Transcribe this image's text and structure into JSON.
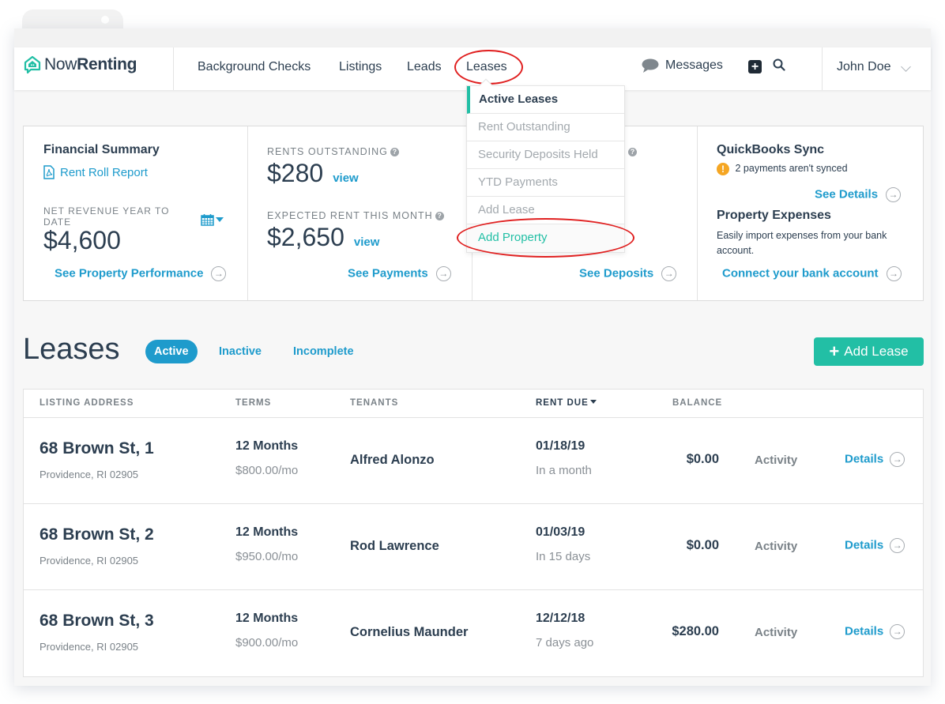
{
  "app": {
    "brand_light": "Now",
    "brand_bold": "Renting",
    "colors": {
      "brand_teal": "#22bfa5",
      "link_blue": "#1e9bcc",
      "text_dark": "#2c3e50",
      "warning": "#f5a623",
      "annotation_red": "#e02020"
    }
  },
  "nav": {
    "items": [
      "Background Checks",
      "Listings",
      "Leads",
      "Leases"
    ],
    "messages_label": "Messages",
    "user_name": "John Doe",
    "icons": {
      "messages": "speech-bubble-icon",
      "add": "plus-square-icon",
      "search": "magnifier-icon",
      "user_menu": "chevron-down-icon"
    }
  },
  "leases_menu": {
    "items": [
      {
        "label": "Active Leases",
        "state": "active"
      },
      {
        "label": "Rent Outstanding",
        "state": "normal"
      },
      {
        "label": "Security Deposits Held",
        "state": "normal"
      },
      {
        "label": "YTD Payments",
        "state": "normal"
      },
      {
        "label": "Add Lease",
        "state": "normal"
      },
      {
        "label": "Add Property",
        "state": "highlighted"
      }
    ]
  },
  "summary": {
    "financial": {
      "title": "Financial Summary",
      "report_link": "Rent Roll Report",
      "net_revenue_label": "NET REVENUE YEAR TO DATE",
      "net_revenue_value": "$4,600",
      "footer_link": "See Property Performance"
    },
    "rents": {
      "outstanding_label": "RENTS OUTSTANDING",
      "outstanding_value": "$280",
      "outstanding_view": "view",
      "expected_label": "EXPECTED RENT THIS MONTH",
      "expected_value": "$2,650",
      "expected_view": "view",
      "footer_link": "See Payments"
    },
    "deposits": {
      "footer_link": "See Deposits"
    },
    "quickbooks": {
      "title": "QuickBooks Sync",
      "warning_text": "2 payments aren't synced",
      "details_link": "See Details",
      "expenses_title": "Property Expenses",
      "expenses_text": "Easily import expenses from your bank account.",
      "connect_link": "Connect your bank account"
    }
  },
  "leases": {
    "title": "Leases",
    "filters": [
      "Active",
      "Inactive",
      "Incomplete"
    ],
    "active_filter": "Active",
    "add_button": "Add Lease",
    "columns": [
      "LISTING ADDRESS",
      "TERMS",
      "TENANTS",
      "RENT DUE",
      "BALANCE"
    ],
    "sorted_column": "RENT DUE",
    "rows": [
      {
        "address": "68 Brown St, 1",
        "city": "Providence, RI 02905",
        "term": "12 Months",
        "rate": "$800.00/mo",
        "tenant": "Alfred Alonzo",
        "due": "01/18/19",
        "due_relative": "In a month",
        "balance": "$0.00",
        "activity": "Activity",
        "details": "Details"
      },
      {
        "address": "68 Brown St, 2",
        "city": "Providence, RI 02905",
        "term": "12 Months",
        "rate": "$950.00/mo",
        "tenant": "Rod Lawrence",
        "due": "01/03/19",
        "due_relative": "In 15 days",
        "balance": "$0.00",
        "activity": "Activity",
        "details": "Details"
      },
      {
        "address": "68 Brown St, 3",
        "city": "Providence, RI 02905",
        "term": "12 Months",
        "rate": "$900.00/mo",
        "tenant": "Cornelius Maunder",
        "due": "12/12/18",
        "due_relative": "7 days ago",
        "balance": "$280.00",
        "activity": "Activity",
        "details": "Details"
      }
    ]
  }
}
